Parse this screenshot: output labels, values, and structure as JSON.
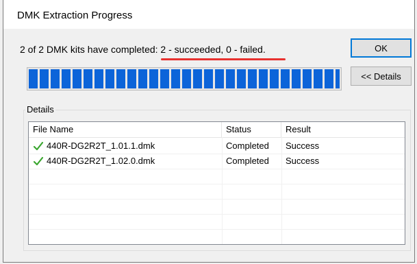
{
  "window": {
    "title": "DMK Extraction Progress"
  },
  "summary": {
    "text": "2 of 2 DMK kits have completed: 2 - succeeded, 0 - failed."
  },
  "buttons": {
    "ok_label": "OK",
    "details_label": "<< Details"
  },
  "progress": {
    "fraction": 1.0
  },
  "details": {
    "group_label": "Details",
    "columns": [
      "File Name",
      "Status",
      "Result"
    ],
    "rows": [
      {
        "file": "440R-DG2R2T_1.01.1.dmk",
        "status": "Completed",
        "result": "Success",
        "icon": "check-icon"
      },
      {
        "file": "440R-DG2R2T_1.02.0.dmk",
        "status": "Completed",
        "result": "Success",
        "icon": "check-icon"
      }
    ]
  },
  "colors": {
    "accent": "#0c64d9",
    "highlight": "#e8312f",
    "check": "#3aa62f"
  }
}
